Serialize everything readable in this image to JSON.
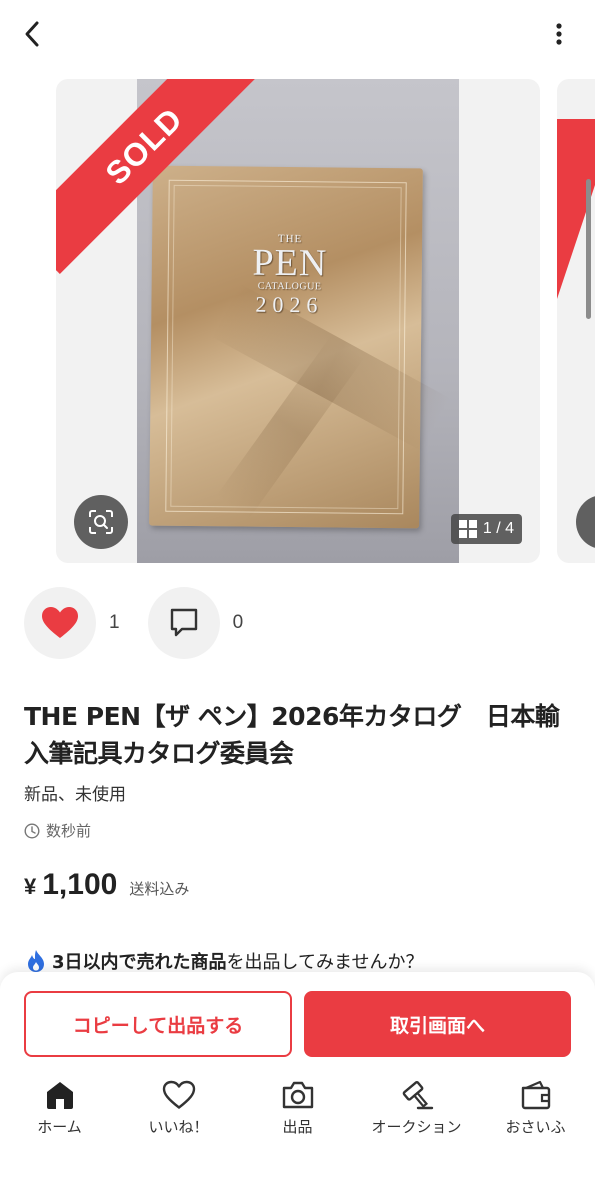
{
  "header": {
    "back_icon": "chevron-left-icon",
    "more_icon": "more-vertical-icon"
  },
  "gallery": {
    "sold_label": "SOLD",
    "counter": "1 / 4",
    "cover": {
      "the": "THE",
      "pen": "PEN",
      "catalogue": "CATALOGUE",
      "year": "2026"
    }
  },
  "actions": {
    "like_count": "1",
    "comment_count": "0"
  },
  "item": {
    "title": "THE PEN【ザ ペン】2026年カタログ　日本輸入筆記具カタログ委員会",
    "condition": "新品、未使用",
    "posted": "数秒前",
    "price_symbol": "¥",
    "price": "1,100",
    "shipping_note": "送料込み"
  },
  "promo": {
    "bold": "3日以内で売れた商品",
    "rest": "を出品してみませんか？"
  },
  "buttons": {
    "copy": "コピーして出品する",
    "trade": "取引画面へ"
  },
  "tabs": [
    {
      "label": "ホーム",
      "icon": "home-icon"
    },
    {
      "label": "いいね！",
      "icon": "heart-outline-icon"
    },
    {
      "label": "出品",
      "icon": "camera-icon"
    },
    {
      "label": "オークション",
      "icon": "gavel-icon"
    },
    {
      "label": "おさいふ",
      "icon": "wallet-icon"
    }
  ],
  "colors": {
    "accent": "#ea3c42",
    "flame": "#2f6fe0"
  }
}
